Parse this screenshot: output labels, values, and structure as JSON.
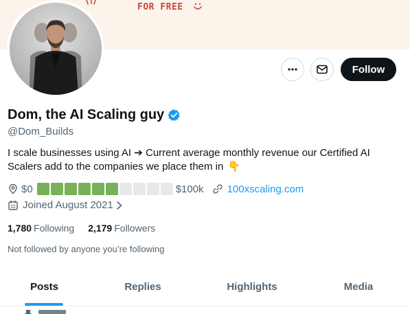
{
  "banner": {
    "text": "FOR FREE",
    "bg_color": "#fcf3ea",
    "text_color": "#c44a3e"
  },
  "profile": {
    "display_name": "Dom, the AI Scaling guy",
    "verified_icon": "verified-badge-icon",
    "handle": "@Dom_Builds",
    "bio": "I scale businesses using AI ➔ Current average monthly revenue our Certified AI Scalers add to the companies we place them in",
    "bio_emoji": "👇",
    "location_start": "$0",
    "progress_total": 10,
    "progress_filled": 6,
    "location_end": "$100k",
    "website": "100xscaling.com",
    "joined": "Joined August 2021"
  },
  "actions": {
    "more_icon": "more-dots-icon",
    "message_icon": "envelope-icon",
    "follow_label": "Follow"
  },
  "stats": {
    "following_count": "1,780",
    "following_label": "Following",
    "followers_count": "2,179",
    "followers_label": "Followers"
  },
  "followed_by_note": "Not followed by anyone you’re following",
  "tabs": [
    {
      "label": "Posts",
      "active": true
    },
    {
      "label": "Replies",
      "active": false
    },
    {
      "label": "Highlights",
      "active": false
    },
    {
      "label": "Media",
      "active": false
    }
  ],
  "colors": {
    "accent": "#1d9bf0",
    "progress_filled": "#78b159",
    "progress_empty": "#e6e8ea",
    "text_primary": "#0f1419",
    "text_secondary": "#536471"
  }
}
